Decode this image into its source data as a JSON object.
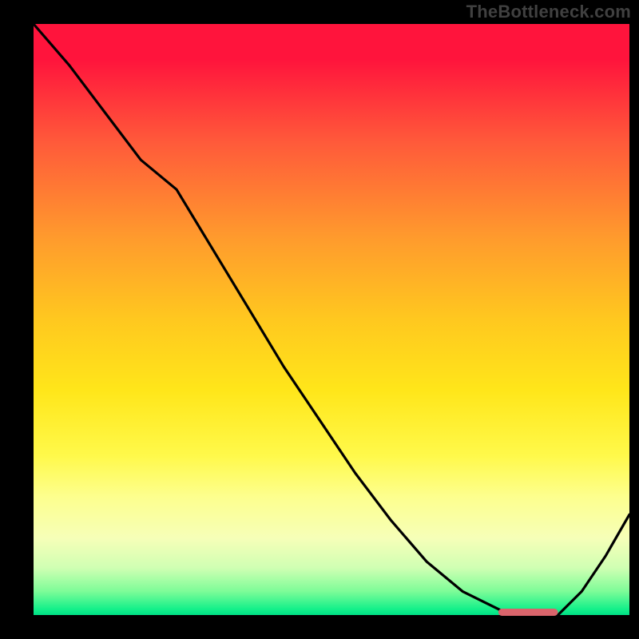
{
  "attribution": "TheBottleneck.com",
  "chart_data": {
    "type": "line",
    "title": "",
    "xlabel": "",
    "ylabel": "",
    "x": [
      0.0,
      0.06,
      0.12,
      0.18,
      0.24,
      0.3,
      0.36,
      0.42,
      0.48,
      0.54,
      0.6,
      0.66,
      0.72,
      0.78,
      0.8,
      0.84,
      0.88,
      0.92,
      0.96,
      1.0
    ],
    "values": [
      1.0,
      0.93,
      0.85,
      0.77,
      0.72,
      0.62,
      0.52,
      0.42,
      0.33,
      0.24,
      0.16,
      0.09,
      0.04,
      0.01,
      0.0,
      0.0,
      0.0,
      0.04,
      0.1,
      0.17
    ],
    "xlim": [
      0,
      1
    ],
    "ylim": [
      0,
      1
    ],
    "grid": false,
    "legend": false,
    "flat_segment": {
      "x0": 0.78,
      "x1": 0.88,
      "y": 0.0
    },
    "colors": {
      "curve": "#000000",
      "flat_marker": "#d9646b",
      "gradient_top": "#ff143c",
      "gradient_bottom": "#00e086"
    }
  }
}
